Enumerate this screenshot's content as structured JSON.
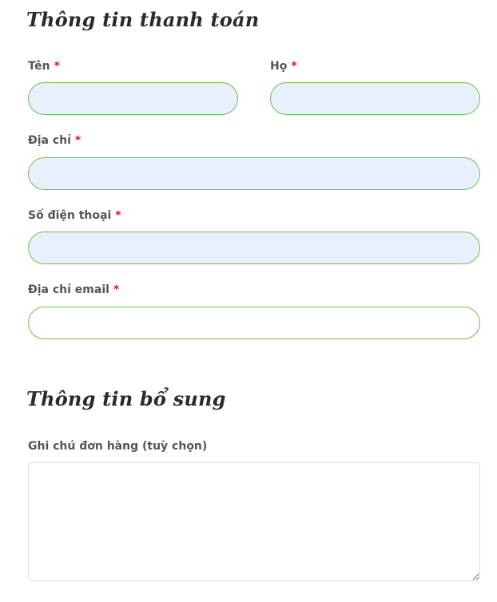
{
  "billing": {
    "title": "Thông tin thanh toán",
    "first_name": {
      "label": "Tên",
      "value": ""
    },
    "last_name": {
      "label": "Họ",
      "value": ""
    },
    "address": {
      "label": "Địa chỉ",
      "value": ""
    },
    "phone": {
      "label": "Số điện thoại",
      "value": ""
    },
    "email": {
      "label": "Địa chỉ email",
      "value": ""
    },
    "required_mark": "*"
  },
  "additional": {
    "title": "Thông tin bổ sung",
    "notes": {
      "label": "Ghi chú đơn hàng (tuỳ chọn)",
      "value": ""
    }
  },
  "colors": {
    "field_border": "#6cc04a",
    "autofill_background": "#e8f0fe",
    "required": "#e0141e"
  }
}
